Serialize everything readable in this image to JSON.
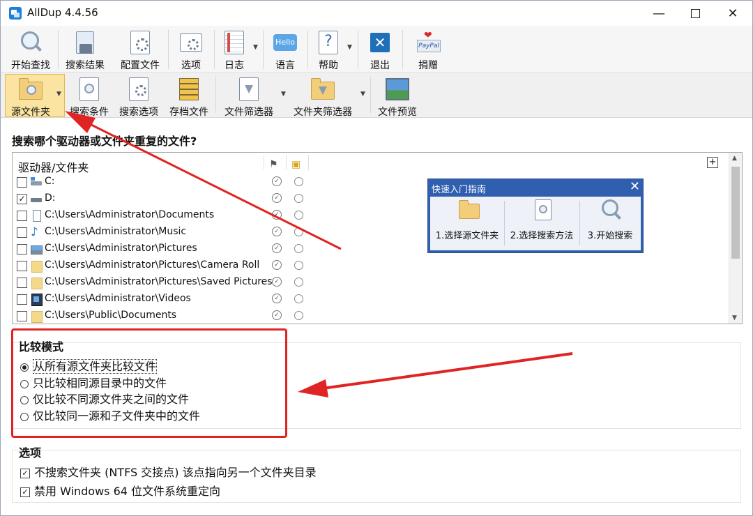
{
  "window": {
    "title": "AllDup 4.4.56"
  },
  "toolbar1": [
    {
      "label": "开始查找",
      "icon": "search-magnifier-icon"
    },
    {
      "label": "搜索结果",
      "icon": "search-results-icon"
    },
    {
      "label": "配置文件",
      "icon": "profile-gear-icon"
    },
    {
      "label": "选项",
      "icon": "options-gear-icon"
    },
    {
      "label": "日志",
      "icon": "log-icon"
    },
    {
      "label": "语言",
      "icon": "language-hello-icon",
      "badge": "Hello"
    },
    {
      "label": "帮助",
      "icon": "help-icon"
    },
    {
      "label": "退出",
      "icon": "exit-icon"
    },
    {
      "label": "捐赠",
      "icon": "paypal-donate-icon",
      "badge": "PayPal"
    }
  ],
  "toolbar2": [
    {
      "label": "源文件夹",
      "icon": "source-folder-icon",
      "selected": true
    },
    {
      "label": "搜索条件",
      "icon": "search-criteria-icon"
    },
    {
      "label": "搜索选项",
      "icon": "search-options-icon"
    },
    {
      "label": "存档文件",
      "icon": "archive-icon"
    },
    {
      "label": "文件筛选器",
      "icon": "file-filter-icon"
    },
    {
      "label": "文件夹筛选器",
      "icon": "folder-filter-icon"
    },
    {
      "label": "文件预览",
      "icon": "file-preview-icon"
    }
  ],
  "main": {
    "question": "搜索哪个驱动器或文件夹重复的文件?",
    "list_header": "驱动器/文件夹",
    "rows": [
      {
        "path": "C:",
        "checked": false,
        "icon": "drive-icon"
      },
      {
        "path": "D:",
        "checked": true,
        "icon": "drive-icon"
      },
      {
        "path": "C:\\Users\\Administrator\\Documents",
        "checked": false,
        "icon": "document-icon"
      },
      {
        "path": "C:\\Users\\Administrator\\Music",
        "checked": false,
        "icon": "music-note-icon"
      },
      {
        "path": "C:\\Users\\Administrator\\Pictures",
        "checked": false,
        "icon": "picture-icon"
      },
      {
        "path": "C:\\Users\\Administrator\\Pictures\\Camera Roll",
        "checked": false,
        "icon": "folder-icon"
      },
      {
        "path": "C:\\Users\\Administrator\\Pictures\\Saved Pictures",
        "checked": false,
        "icon": "folder-icon"
      },
      {
        "path": "C:\\Users\\Administrator\\Videos",
        "checked": false,
        "icon": "video-icon"
      },
      {
        "path": "C:\\Users\\Public\\Documents",
        "checked": false,
        "icon": "folder-icon"
      }
    ]
  },
  "quickstart": {
    "title": "快速入门指南",
    "steps": [
      "1.选择源文件夹",
      "2.选择搜索方法",
      "3.开始搜索"
    ]
  },
  "compare": {
    "title": "比较模式",
    "options": [
      {
        "label": "从所有源文件夹比较文件",
        "selected": true
      },
      {
        "label": "只比较相同源目录中的文件",
        "selected": false
      },
      {
        "label": "仅比较不同源文件夹之间的文件",
        "selected": false
      },
      {
        "label": "仅比较同一源和子文件夹中的文件",
        "selected": false
      }
    ]
  },
  "options": {
    "title": "选项",
    "items": [
      {
        "label": "不搜索文件夹 (NTFS 交接点) 该点指向另一个文件夹目录",
        "checked": true
      },
      {
        "label": "禁用 Windows 64 位文件系统重定向",
        "checked": true
      }
    ]
  },
  "colors": {
    "accent_red": "#e02323",
    "quickstart_blue": "#2f5fae",
    "selected_bg": "#fbe4a1"
  }
}
